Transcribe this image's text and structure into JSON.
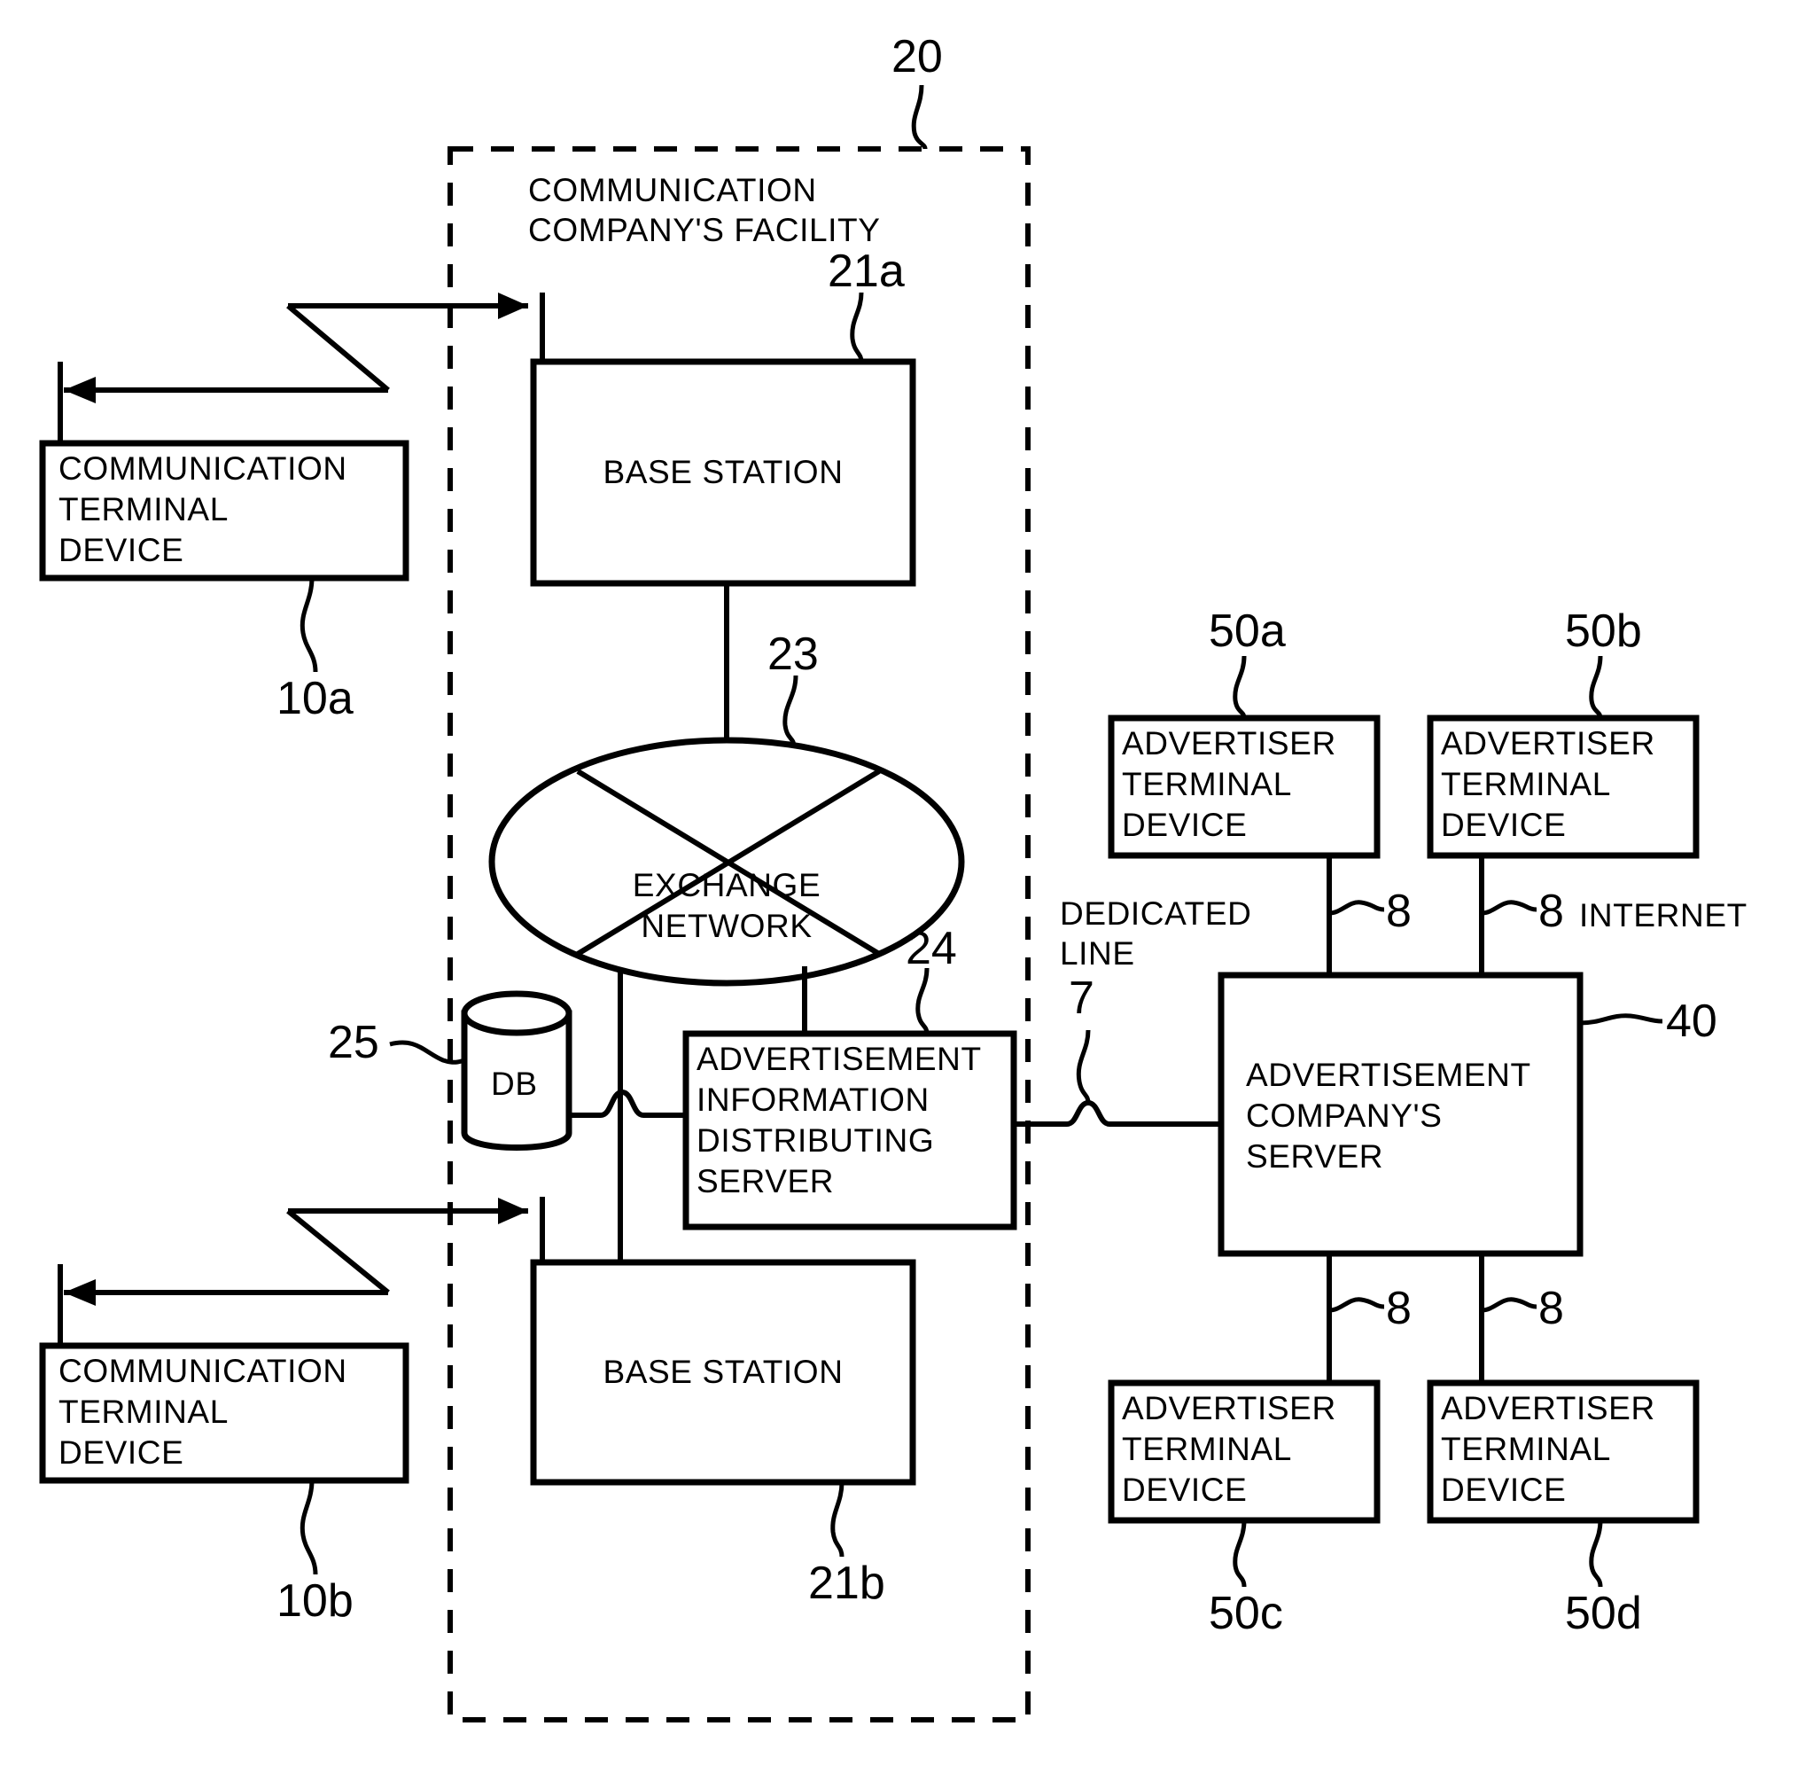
{
  "figure": {
    "type": "patent-block-diagram",
    "background": "#ffffff",
    "stroke_color": "#000000"
  },
  "facility": {
    "label": "COMMUNICATION\nCOMPANY'S FACILITY",
    "ref": "20"
  },
  "nodes": {
    "base_station_top": {
      "label": "BASE  STATION",
      "ref": "21a"
    },
    "base_station_bottom": {
      "label": "BASE  STATION",
      "ref": "21b"
    },
    "exchange_network": {
      "label": "EXCHANGE\nNETWORK",
      "ref": "23"
    },
    "ad_info_server": {
      "label": "ADVERTISEMENT\nINFORMATION\nDISTRIBUTING\nSERVER",
      "ref": "24"
    },
    "database": {
      "label": "DB",
      "ref": "25"
    },
    "terminal_a": {
      "label": "COMMUNICATION\nTERMINAL\nDEVICE",
      "ref": "10a"
    },
    "terminal_b": {
      "label": "COMMUNICATION\nTERMINAL\nDEVICE",
      "ref": "10b"
    },
    "ad_company_server": {
      "label": "ADVERTISEMENT\nCOMPANY'S\nSERVER",
      "ref": "40"
    },
    "advertiser_a": {
      "label": "ADVERTISER\nTERMINAL\nDEVICE",
      "ref": "50a"
    },
    "advertiser_b": {
      "label": "ADVERTISER\nTERMINAL\nDEVICE",
      "ref": "50b"
    },
    "advertiser_c": {
      "label": "ADVERTISER\nTERMINAL\nDEVICE",
      "ref": "50c"
    },
    "advertiser_d": {
      "label": "ADVERTISER\nTERMINAL\nDEVICE",
      "ref": "50d"
    }
  },
  "links": {
    "dedicated_line": {
      "label": "DEDICATED\nLINE",
      "ref": "7"
    },
    "internet": {
      "label": "INTERNET"
    },
    "internet_refs": {
      "top_left": "8",
      "top_right": "8",
      "bottom_left": "8",
      "bottom_right": "8"
    }
  }
}
